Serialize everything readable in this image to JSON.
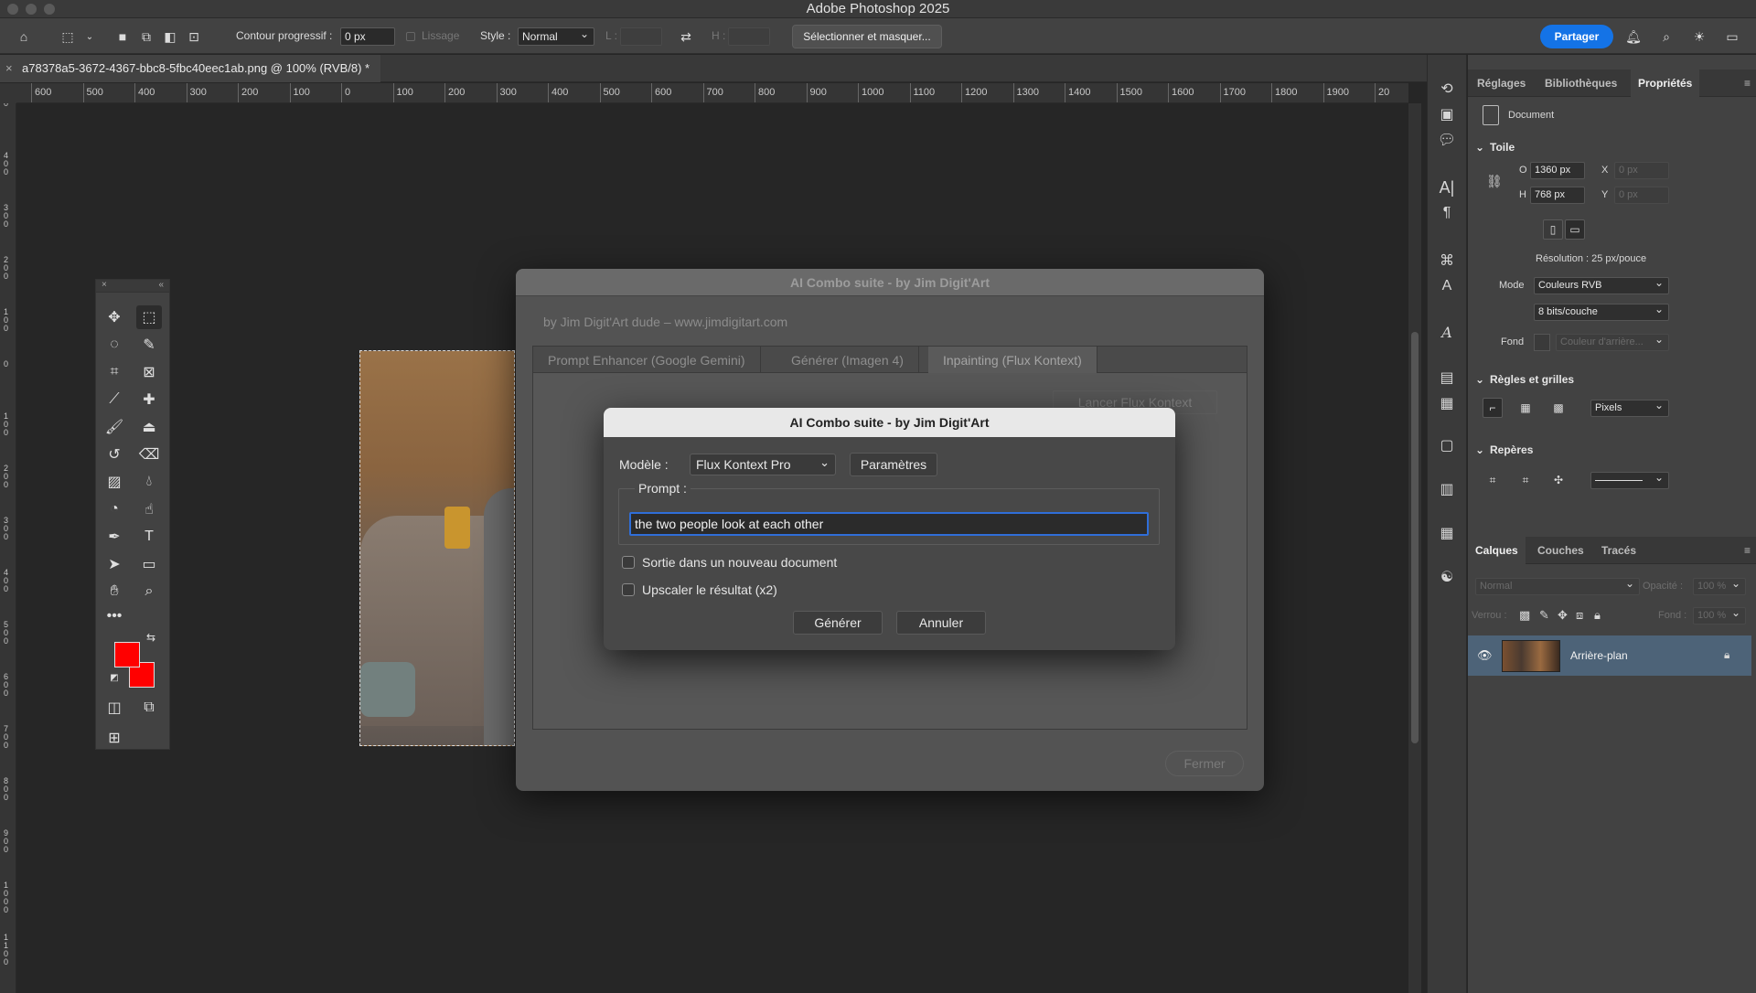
{
  "app": {
    "title": "Adobe Photoshop 2025"
  },
  "options_bar": {
    "feather_label": "Contour progressif :",
    "feather_value": "0 px",
    "antialias_label": "Lissage",
    "style_label": "Style :",
    "style_value": "Normal",
    "width_label": "L :",
    "height_label": "H :",
    "select_mask_label": "Sélectionner et masquer...",
    "share_label": "Partager"
  },
  "document": {
    "tab_title": "a78378a5-3672-4367-bbc8-5fbc40eec1ab.png @ 100% (RVB/8) *",
    "close_glyph": "×"
  },
  "ruler": {
    "h_labels": [
      "600",
      "500",
      "400",
      "300",
      "200",
      "100",
      "0",
      "100",
      "200",
      "300",
      "400",
      "500",
      "600",
      "700",
      "800",
      "900",
      "1000",
      "1100",
      "1200",
      "1300",
      "1400",
      "1500",
      "1600",
      "1700",
      "1800",
      "1900",
      "20"
    ],
    "v_labels": [
      "0",
      "4\n0\n0",
      "3\n0\n0",
      "2\n0\n0",
      "1\n0\n0",
      "0",
      "1\n0\n0",
      "2\n0\n0",
      "3\n0\n0",
      "4\n0\n0",
      "5\n0\n0",
      "6\n0\n0",
      "7\n0\n0",
      "8\n0\n0",
      "9\n0\n0",
      "1\n0\n0\n0",
      "1\n1\n0\n0"
    ]
  },
  "colors": {
    "foreground": "#ff0000",
    "background": "#ff0000",
    "accent": "#1473e6",
    "layer_selected": "#4d6378"
  },
  "tools": [
    "move-tool-icon",
    "marquee-tool-icon",
    "object-select-icon",
    "quick-select-icon",
    "crop-tool-icon",
    "frame-tool-icon",
    "eyedropper-icon",
    "healing-brush-icon",
    "brush-tool-icon",
    "clone-stamp-icon",
    "history-brush-icon",
    "eraser-icon",
    "gradient-tool-icon",
    "blur-tool-icon",
    "dodge-tool-icon",
    "smudge-tool-icon",
    "pen-tool-icon",
    "type-tool-icon",
    "path-select-icon",
    "rectangle-tool-icon",
    "hand-tool-icon",
    "zoom-tool-icon"
  ],
  "right_panel": {
    "tabs": [
      "Réglages",
      "Bibliothèques",
      "Propriétés"
    ],
    "document_label": "Document",
    "canvas_section": "Toile",
    "width_label": "O",
    "width_value": "1360 px",
    "height_label": "H",
    "height_value": "768 px",
    "x_label": "X",
    "x_value": "0 px",
    "y_label": "Y",
    "y_value": "0 px",
    "resolution": "Résolution : 25 px/pouce",
    "mode_label": "Mode",
    "mode_value": "Couleurs RVB",
    "bits_value": "8 bits/couche",
    "fond_label": "Fond",
    "fond_value": "Couleur d'arrière...",
    "rulers_section": "Règles et grilles",
    "units_value": "Pixels",
    "guides_section": "Repères",
    "layer_tabs": [
      "Calques",
      "Couches",
      "Tracés"
    ],
    "blend_value": "Normal",
    "opacity_label": "Opacité :",
    "opacity_value": "100 %",
    "lock_label": "Verrou :",
    "fill_label": "Fond :",
    "fill_value": "100 %",
    "layer_name": "Arrière-plan"
  },
  "plugin_window": {
    "title": "AI Combo suite - by Jim Digit'Art",
    "subtitle": "by Jim Digit'Art dude   –   www.jimdigitart.com",
    "tabs": [
      "Prompt Enhancer (Google Gemini)",
      "Générer (Imagen 4)",
      "Inpainting (Flux Kontext)"
    ],
    "launch_label": "Lancer Flux Kontext",
    "close_label": "Fermer"
  },
  "dialog": {
    "title": "AI Combo suite - by Jim Digit'Art",
    "model_label": "Modèle :",
    "model_value": "Flux Kontext Pro",
    "params_label": "Paramètres",
    "prompt_label": "Prompt :",
    "prompt_value": "the two people look at each other",
    "option_new_doc": "Sortie dans un nouveau document",
    "option_upscale": "Upscaler le résultat (x2)",
    "generate_label": "Générer",
    "cancel_label": "Annuler"
  }
}
